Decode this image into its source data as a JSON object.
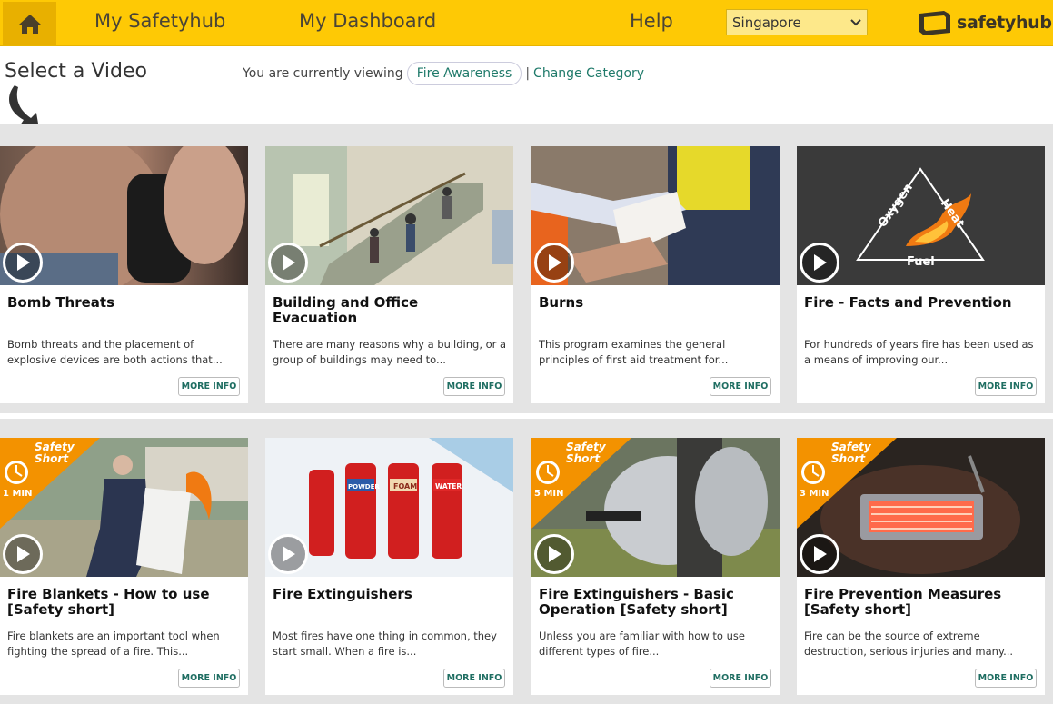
{
  "nav": {
    "home_icon": "home-icon",
    "my_safetyhub": "My Safetyhub",
    "my_dashboard": "My Dashboard",
    "help": "Help",
    "region_selected": "Singapore",
    "brand": "safetyhub"
  },
  "header": {
    "title": "Select a Video",
    "viewing_prefix": "You are currently viewing",
    "category": "Fire Awareness",
    "separator": "|",
    "change_category": "Change Category"
  },
  "more_info_label": "MORE INFO",
  "videos": [
    {
      "title": "Bomb Threats",
      "desc": "Bomb threats and the placement of explosive devices are both actions that..."
    },
    {
      "title": "Building and Office Evacuation",
      "desc": "There are many reasons why a building, or a group of buildings may need to..."
    },
    {
      "title": "Burns",
      "desc": "This program examines the general principles of first aid treatment for..."
    },
    {
      "title": "Fire - Facts and Prevention",
      "desc": "For hundreds of years fire has been used as a means of improving our..."
    },
    {
      "title": "Fire Blankets - How to use [Safety short]",
      "desc": "Fire blankets are an important tool when fighting the spread of a fire. This...",
      "badge": "1 MIN"
    },
    {
      "title": "Fire Extinguishers",
      "desc": "Most fires have one thing in common, they start small.   When a fire is..."
    },
    {
      "title": "Fire Extinguishers - Basic Operation [Safety short]",
      "desc": "Unless you are familiar with how to use different types of fire...",
      "badge": "5 MIN"
    },
    {
      "title": "Fire Prevention Measures [Safety short]",
      "desc": "Fire can be the source of extreme destruction, serious injuries and many...",
      "badge": "3 MIN"
    }
  ],
  "safety_short_label_1": "Safety",
  "safety_short_label_2": "Short",
  "thumb_text": {
    "triangle_oxygen": "Oxygen",
    "triangle_heat": "Heat",
    "triangle_fuel": "Fuel",
    "ext_powder": "POWDER",
    "ext_foam": "FOAM",
    "ext_water": "WATER"
  },
  "colors": {
    "nav_bg": "#fec905",
    "accent_teal": "#1f7a6a",
    "badge_orange": "#f39200"
  }
}
